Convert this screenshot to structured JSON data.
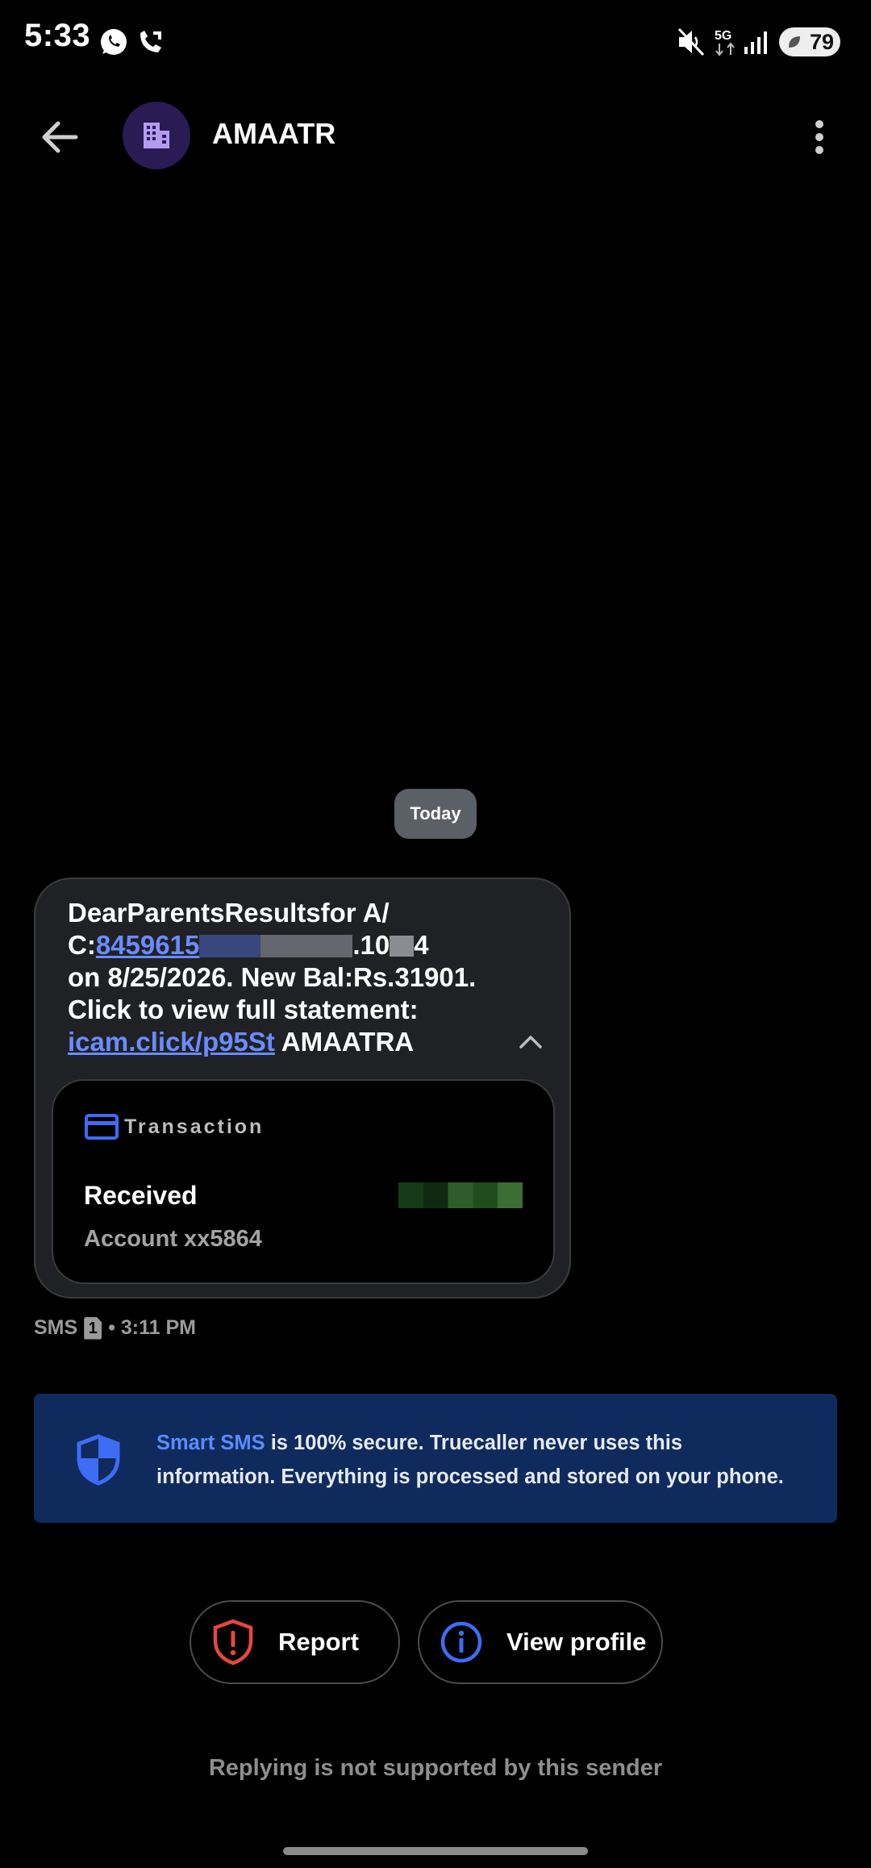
{
  "status_bar": {
    "time": "5:33",
    "battery": "79",
    "network": "5G"
  },
  "header": {
    "sender": "AMAATR"
  },
  "conversation": {
    "date_chip": "Today",
    "message": {
      "line1": "DearParentsResultsfor A/",
      "line2_prefix": "C:",
      "account_link_visible": "8459615",
      "line2_mid": ".10",
      "line2_end": "4",
      "line3": "on 8/25/2026. New Bal:Rs.31901.",
      "line4": "Click to view full statement:",
      "link": "icam.click/p95St",
      "signature": " AMAATRA"
    },
    "transaction": {
      "title": "Transaction",
      "status": "Received",
      "account": "Account xx5864"
    },
    "meta": {
      "type": "SMS",
      "sim": "1",
      "time": "• 3:11 PM"
    }
  },
  "banner": {
    "accent": "Smart SMS",
    "text": " is 100% secure. Truecaller never uses this information. Everything is processed and stored on your phone."
  },
  "actions": {
    "report_label": "Report",
    "profile_label": "View profile"
  },
  "footer": {
    "note": "Replying is not supported by this sender"
  },
  "colors": {
    "background": "#000000",
    "bubble": "#202124",
    "link": "#6a8cff",
    "banner": "#0f2a5c",
    "accent_blue": "#3d6cf5",
    "report_red": "#e5483d"
  },
  "icons": {
    "back": "arrow-left-icon",
    "avatar": "building-icon",
    "more": "more-vert-icon",
    "collapse": "chevron-up-icon",
    "card": "credit-card-icon",
    "shield": "shield-icon",
    "report": "report-shield-icon",
    "info": "info-icon"
  }
}
